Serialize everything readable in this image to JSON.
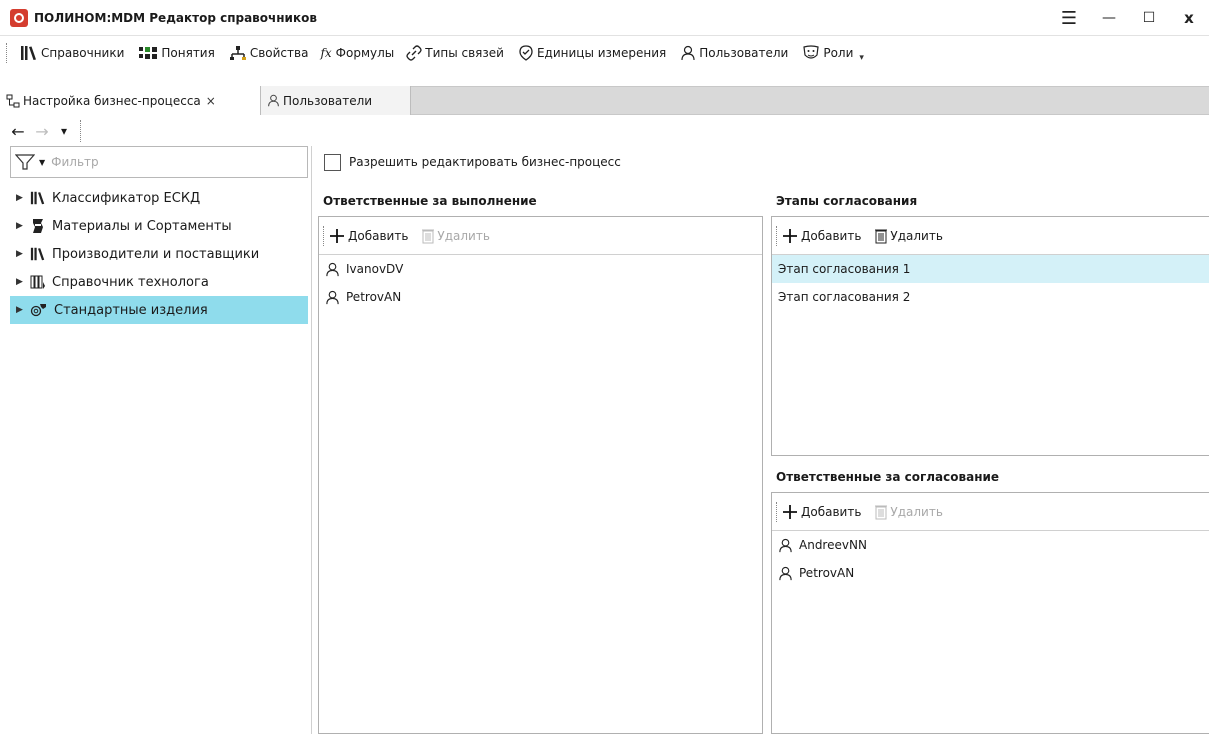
{
  "window": {
    "title": "ПОЛИНОМ:MDM Редактор справочников",
    "controls": {
      "menu": "☰",
      "minimize": "—",
      "maximize": "☐",
      "close": "x"
    }
  },
  "toolbar": {
    "items": [
      {
        "label": "Справочники",
        "icon": "books-icon"
      },
      {
        "label": "Понятия",
        "icon": "concepts-icon"
      },
      {
        "label": "Свойства",
        "icon": "properties-icon"
      },
      {
        "label": "Формулы",
        "icon": "formula-icon"
      },
      {
        "label": "Типы связей",
        "icon": "link-icon"
      },
      {
        "label": "Единицы измерения",
        "icon": "units-icon"
      },
      {
        "label": "Пользователи",
        "icon": "user-icon"
      },
      {
        "label": "Роли",
        "icon": "mask-icon"
      }
    ],
    "formula_prefix": "fx"
  },
  "tabs": [
    {
      "label": "Настройка бизнес-процесса",
      "active": true,
      "close": "×"
    },
    {
      "label": "Пользователи",
      "active": false
    }
  ],
  "nav": {
    "back": "←",
    "forward": "→",
    "dropdown": "▾"
  },
  "filter": {
    "placeholder": "Фильтр"
  },
  "tree": [
    {
      "label": "Классификатор ЕСКД",
      "icon": "books-icon",
      "selected": false
    },
    {
      "label": "Материалы и Сортаменты",
      "icon": "materials-icon",
      "selected": false
    },
    {
      "label": "Производители и поставщики",
      "icon": "books-icon",
      "selected": false
    },
    {
      "label": "Справочник технолога",
      "icon": "binders-icon",
      "selected": false
    },
    {
      "label": "Стандартные изделия",
      "icon": "standard-parts-icon",
      "selected": true
    }
  ],
  "edit_checkbox": {
    "label": "Разрешить редактировать бизнес-процесс",
    "checked": false
  },
  "executors": {
    "title": "Ответственные за выполнение",
    "add": "Добавить",
    "remove": "Удалить",
    "items": [
      "IvanovDV",
      "PetrovAN"
    ]
  },
  "stages": {
    "title": "Этапы согласования",
    "add": "Добавить",
    "remove": "Удалить",
    "items": [
      "Этап согласования 1",
      "Этап согласования 2"
    ]
  },
  "approvers": {
    "title": "Ответственные за согласование",
    "add": "Добавить",
    "remove": "Удалить",
    "items": [
      "AndreevNN",
      "PetrovAN"
    ]
  },
  "colors": {
    "accent": "#8fdcec",
    "selection_light": "#d4f1f8",
    "logo": "#d43d2f"
  }
}
